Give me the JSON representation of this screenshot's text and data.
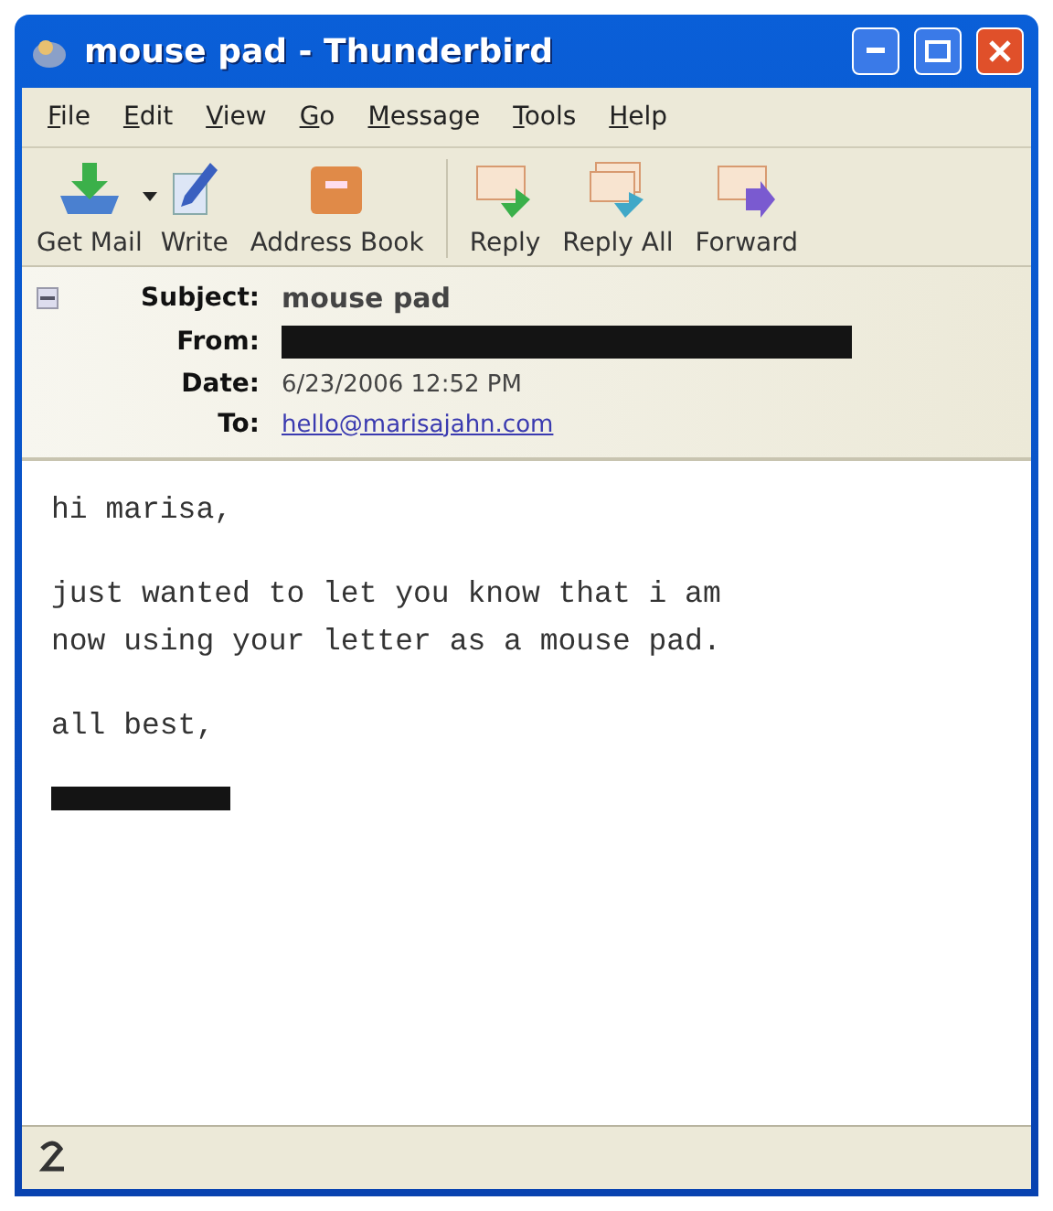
{
  "window": {
    "title": "mouse pad - Thunderbird"
  },
  "menu": [
    "File",
    "Edit",
    "View",
    "Go",
    "Message",
    "Tools",
    "Help"
  ],
  "toolbar": [
    {
      "label": "Get Mail",
      "kind": "getmail",
      "dropdown": true
    },
    {
      "label": "Write",
      "kind": "write",
      "dropdown": false
    },
    {
      "label": "Address Book",
      "kind": "addressbook",
      "dropdown": false
    },
    {
      "kind": "separator"
    },
    {
      "label": "Reply",
      "kind": "reply",
      "dropdown": false
    },
    {
      "label": "Reply All",
      "kind": "replyall",
      "dropdown": false
    },
    {
      "label": "Forward",
      "kind": "forward",
      "dropdown": false
    }
  ],
  "header": {
    "expanded": true,
    "fields": [
      {
        "label": "Subject:",
        "value": "mouse pad",
        "kind": "bold"
      },
      {
        "label": "From:",
        "kind": "redacted"
      },
      {
        "label": "Date:",
        "value": "6/23/2006 12:52 PM",
        "kind": "plain"
      },
      {
        "label": "To:",
        "value": "hello@marisajahn.com",
        "kind": "link"
      }
    ]
  },
  "body": [
    {
      "kind": "text",
      "lines": [
        "hi marisa,"
      ]
    },
    {
      "kind": "text",
      "lines": [
        "just wanted to let you know that i am",
        "now using your letter as a mouse pad."
      ]
    },
    {
      "kind": "text",
      "lines": [
        "all best,"
      ]
    },
    {
      "kind": "redacted"
    }
  ]
}
